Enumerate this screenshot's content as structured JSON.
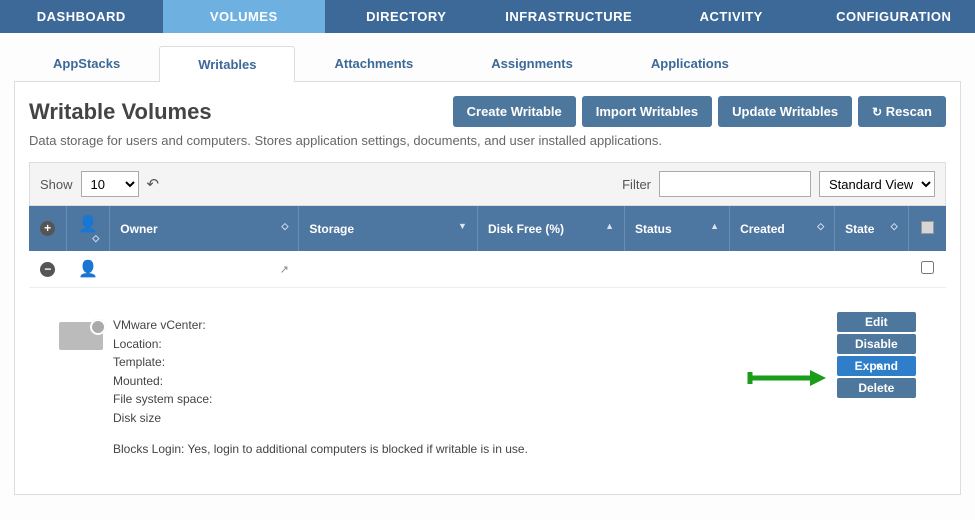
{
  "nav": {
    "items": [
      "DASHBOARD",
      "VOLUMES",
      "DIRECTORY",
      "INFRASTRUCTURE",
      "ACTIVITY",
      "CONFIGURATION"
    ],
    "active": 1
  },
  "subnav": {
    "items": [
      "AppStacks",
      "Writables",
      "Attachments",
      "Assignments",
      "Applications"
    ],
    "active": 1
  },
  "page": {
    "title": "Writable Volumes",
    "description": "Data storage for users and computers. Stores application settings, documents, and user installed applications."
  },
  "action_buttons": {
    "create": "Create Writable",
    "import": "Import Writables",
    "update": "Update Writables",
    "rescan": "Rescan"
  },
  "controls": {
    "show_label": "Show",
    "show_value": "10",
    "filter_label": "Filter",
    "filter_value": "",
    "view_value": "Standard View"
  },
  "columns": {
    "owner": "Owner",
    "storage": "Storage",
    "diskfree": "Disk Free (%)",
    "status": "Status",
    "created": "Created",
    "state": "State"
  },
  "row": {
    "owner": "",
    "storage": "",
    "diskfree": "",
    "status": "",
    "created": "",
    "state": ""
  },
  "details": {
    "vcenter_label": "VMware vCenter:",
    "location_label": "Location:",
    "template_label": "Template:",
    "mounted_label": "Mounted:",
    "fss_label": "File system space:",
    "disksize_label": "Disk size",
    "blocks_login": "Blocks Login: Yes, login to additional computers is blocked if writable is in use."
  },
  "detail_buttons": {
    "edit": "Edit",
    "disable": "Disable",
    "expand": "Expand",
    "delete": "Delete"
  }
}
